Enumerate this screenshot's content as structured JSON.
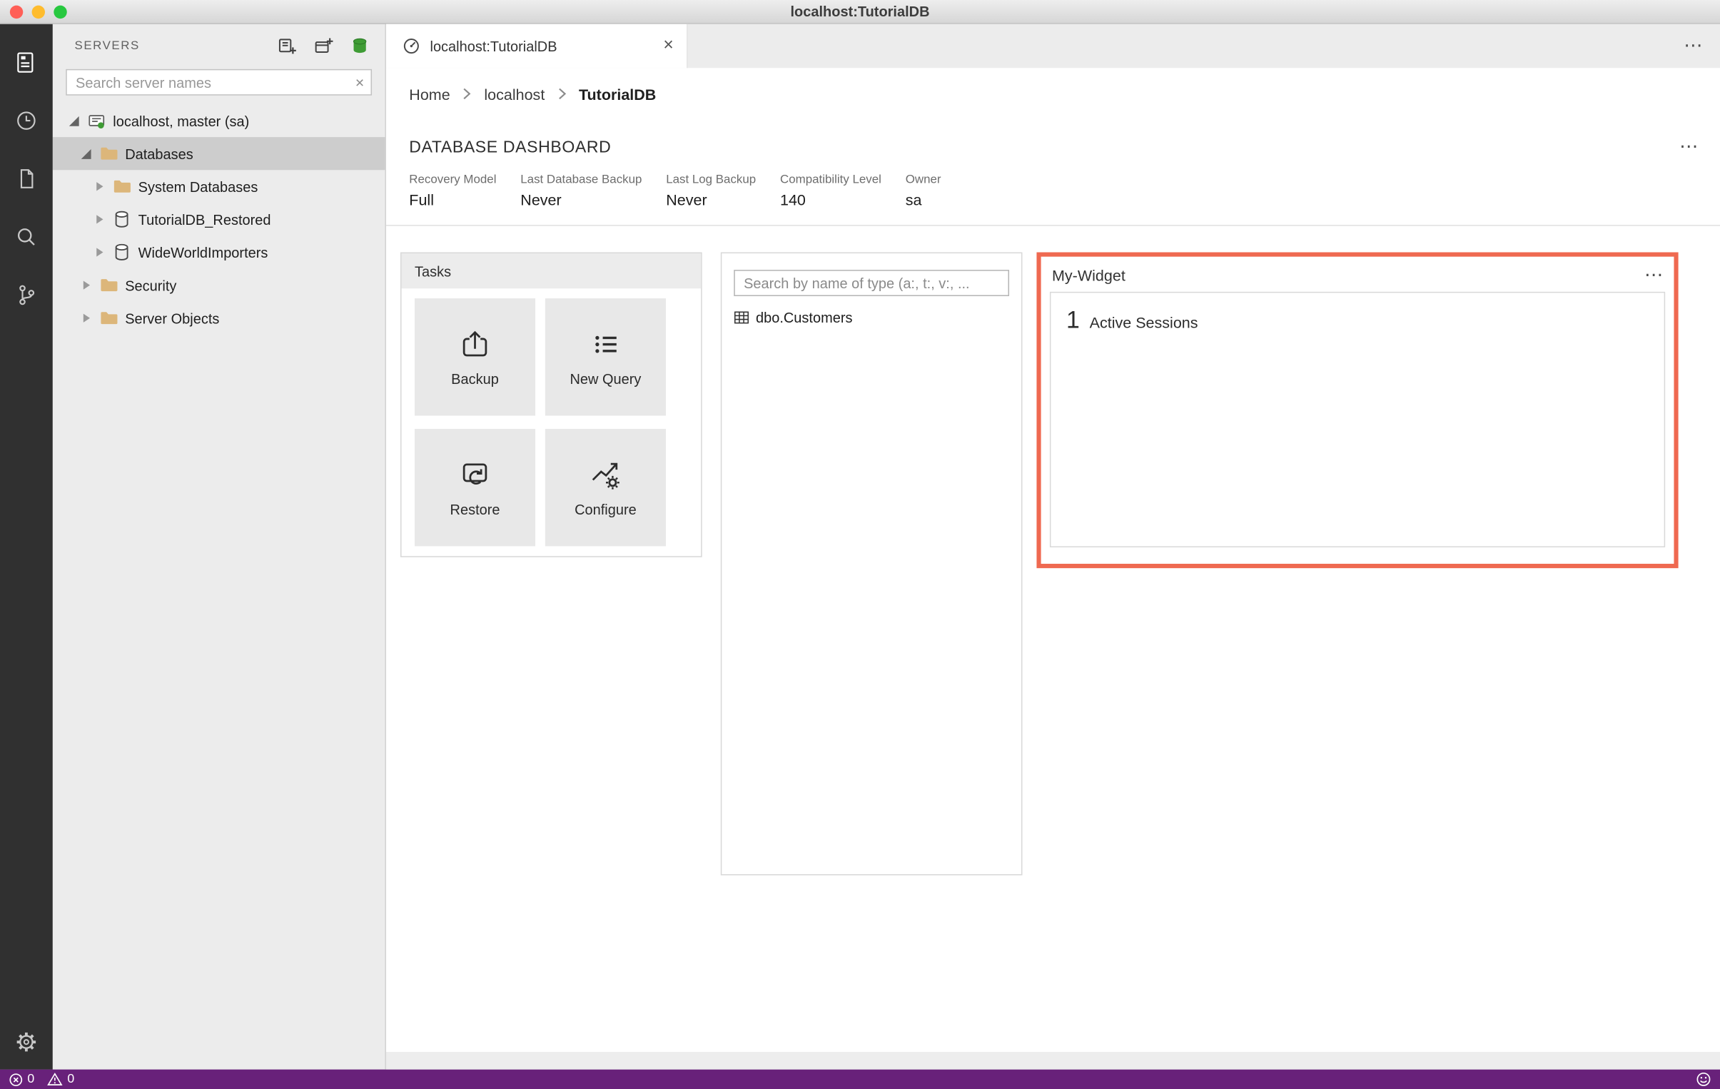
{
  "window": {
    "title": "localhost:TutorialDB"
  },
  "sidebar": {
    "title": "SERVERS",
    "search": {
      "placeholder": "Search server names",
      "clear_label": "×"
    },
    "tree": [
      {
        "label": "localhost, master (sa)",
        "icon": "server-icon",
        "level": 0,
        "expanded": true
      },
      {
        "label": "Databases",
        "icon": "folder-icon",
        "level": 1,
        "expanded": true,
        "selected": true
      },
      {
        "label": "System Databases",
        "icon": "folder-icon",
        "level": 2,
        "expanded": false
      },
      {
        "label": "TutorialDB_Restored",
        "icon": "database-icon",
        "level": 2,
        "expanded": false
      },
      {
        "label": "WideWorldImporters",
        "icon": "database-icon",
        "level": 2,
        "expanded": false
      },
      {
        "label": "Security",
        "icon": "folder-icon",
        "level": 1,
        "expanded": false
      },
      {
        "label": "Server Objects",
        "icon": "folder-icon",
        "level": 1,
        "expanded": false
      }
    ]
  },
  "editor": {
    "tab": {
      "label": "localhost:TutorialDB",
      "close_label": "×"
    },
    "tab_actions_label": "⋯",
    "breadcrumb": {
      "items": [
        {
          "label": "Home"
        },
        {
          "label": "localhost"
        },
        {
          "label": "TutorialDB"
        }
      ]
    },
    "dashboard": {
      "title": "DATABASE DASHBOARD",
      "more_label": "⋯",
      "properties": [
        {
          "label": "Recovery Model",
          "value": "Full"
        },
        {
          "label": "Last Database Backup",
          "value": "Never"
        },
        {
          "label": "Last Log Backup",
          "value": "Never"
        },
        {
          "label": "Compatibility Level",
          "value": "140"
        },
        {
          "label": "Owner",
          "value": "sa"
        }
      ],
      "tasks": {
        "title": "Tasks",
        "buttons": [
          {
            "label": "Backup",
            "icon": "backup-icon"
          },
          {
            "label": "New Query",
            "icon": "new-query-icon"
          },
          {
            "label": "Restore",
            "icon": "restore-icon"
          },
          {
            "label": "Configure",
            "icon": "configure-icon"
          }
        ]
      },
      "explorer": {
        "search_placeholder": "Search by name of type (a:, t:, v:, ...",
        "items": [
          {
            "label": "dbo.Customers",
            "icon": "table-icon"
          }
        ]
      },
      "my_widget": {
        "title": "My-Widget",
        "more_label": "⋯",
        "count": "1",
        "label": "Active Sessions",
        "highlight_color": "#EF6950"
      }
    }
  },
  "status_bar": {
    "errors": "0",
    "warnings": "0",
    "background": "#68217A"
  },
  "icons": {
    "window_controls": [
      "close-circle",
      "minimize-circle",
      "zoom-circle"
    ],
    "activity_bar": [
      "servers-icon",
      "task-history-icon",
      "documents-icon",
      "search-icon",
      "source-control-icon",
      "settings-gear-icon"
    ],
    "sidebar_actions": [
      "new-connection-icon",
      "new-server-group-icon",
      "active-connections-icon"
    ],
    "tree": [
      "server-icon",
      "folder-icon",
      "database-icon"
    ],
    "tab": "dashboard-icon",
    "explorer_item": "table-icon",
    "status_bar": [
      "error-icon",
      "warning-icon",
      "smiley-icon"
    ]
  }
}
